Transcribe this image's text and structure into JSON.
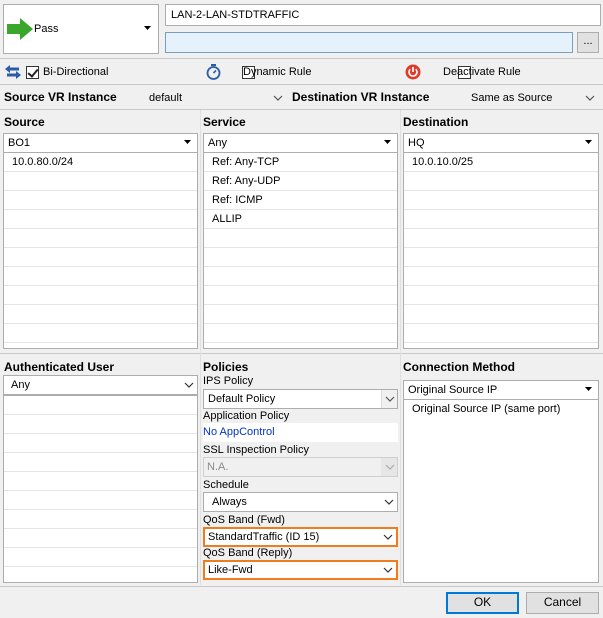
{
  "action": {
    "label": "Pass"
  },
  "rule": {
    "name": "LAN-2-LAN-STDTRAFFIC",
    "comment": "",
    "comment_button": "..."
  },
  "options": {
    "bidirectional": "Bi-Directional",
    "dynamic_rule": "Dynamic Rule",
    "deactivate_rule": "Deactivate Rule"
  },
  "vr": {
    "source_label": "Source VR Instance",
    "source_value": "default",
    "dest_label": "Destination VR Instance",
    "dest_value": "Same as Source"
  },
  "source": {
    "header": "Source",
    "selected": "BO1",
    "items": [
      "10.0.80.0/24"
    ]
  },
  "service": {
    "header": "Service",
    "selected": "Any",
    "items": [
      "Ref: Any-TCP",
      "Ref: Any-UDP",
      "Ref: ICMP",
      "ALLIP"
    ]
  },
  "destination": {
    "header": "Destination",
    "selected": "HQ",
    "items": [
      "10.0.10.0/25"
    ]
  },
  "auth_user": {
    "header": "Authenticated User",
    "selected": "Any"
  },
  "policies": {
    "header": "Policies",
    "ips_label": "IPS Policy",
    "ips_value": "Default Policy",
    "app_label": "Application Policy",
    "app_value": "No AppControl",
    "ssl_label": "SSL Inspection Policy",
    "ssl_value": "N.A.",
    "schedule_label": "Schedule",
    "schedule_value": "Always",
    "qos_fwd_label": "QoS Band (Fwd)",
    "qos_fwd_value": "StandardTraffic (ID 15)",
    "qos_reply_label": "QoS Band (Reply)",
    "qos_reply_value": "Like-Fwd"
  },
  "connection": {
    "header": "Connection Method",
    "selected": "Original Source IP",
    "items": [
      "Original Source IP (same port)"
    ]
  },
  "buttons": {
    "ok": "OK",
    "cancel": "Cancel"
  },
  "colors": {
    "accent_orange": "#ee7d20",
    "link_blue": "#0033cc",
    "pass_green": "#3aa62b"
  }
}
